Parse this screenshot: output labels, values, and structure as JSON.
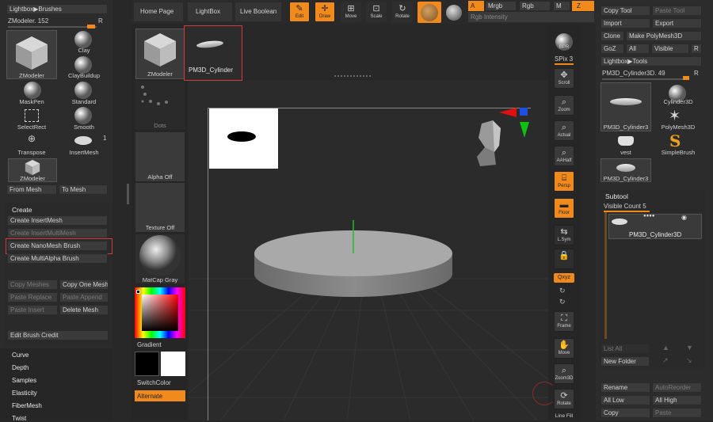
{
  "left": {
    "lightbox_brushes": "Lightbox▶Brushes",
    "zmodeler_value": "ZModeler. 152",
    "r_label": "R",
    "brushes": [
      {
        "name": "ZModeler",
        "icon": "cube-icon"
      },
      {
        "name": "Clay",
        "icon": "sphere-icon"
      },
      {
        "name": "ClayBuildup",
        "icon": "sphere-icon"
      },
      {
        "name": "MaskPen",
        "icon": "sphere-icon"
      },
      {
        "name": "Standard",
        "icon": "sphere-icon"
      },
      {
        "name": "SelectRect",
        "icon": "rect-select-icon"
      },
      {
        "name": "Smooth",
        "icon": "sphere-icon"
      },
      {
        "name": "Transpose",
        "icon": "transpose-icon"
      },
      {
        "name": "InsertMesh",
        "icon": "disc-icon"
      },
      {
        "name": "ZModeler",
        "icon": "cube-icon"
      }
    ],
    "insertmesh_count": "1",
    "from_mesh": "From Mesh",
    "to_mesh": "To Mesh",
    "create_header": "Create",
    "create_insertmesh": "Create InsertMesh",
    "create_insertmultimesh": "Create InsertMultiMesh",
    "create_nanomesh": "Create NanoMesh Brush",
    "create_multialpha": "Create MultiAlpha Brush",
    "copy_meshes": "Copy Meshes",
    "copy_one_mesh": "Copy One Mesh",
    "paste_replace": "Paste Replace",
    "paste_append": "Paste Append",
    "paste_insert": "Paste Insert",
    "delete_mesh": "Delete Mesh",
    "edit_brush_credit": "Edit Brush Credit",
    "menu": [
      "Curve",
      "Depth",
      "Samples",
      "Elasticity",
      "FiberMesh",
      "Twist"
    ]
  },
  "shelf": {
    "zmodeler": "ZModeler",
    "dots": "Dots",
    "alpha_off": "Alpha Off",
    "texture_off": "Texture Off",
    "matcap": "MatCap Gray",
    "gradient": "Gradient",
    "switchcolor": "SwitchColor",
    "alternate": "Alternate"
  },
  "topbar": {
    "tabs": [
      "Home Page",
      "LightBox",
      "Live Boolean"
    ],
    "tools": [
      {
        "label": "Edit",
        "icon": "edit-icon",
        "on": true
      },
      {
        "label": "Draw",
        "icon": "draw-icon",
        "on": true
      },
      {
        "label": "Move",
        "icon": "move-icon",
        "on": false
      },
      {
        "label": "Scale",
        "icon": "scale-icon",
        "on": false
      },
      {
        "label": "Rotate",
        "icon": "rotate-icon",
        "on": false
      }
    ],
    "a_label": "A",
    "mrgb": "Mrgb",
    "rgb": "Rgb",
    "m": "M",
    "z": "Z",
    "rgb_intensity": "Rgb Intensity"
  },
  "popup": {
    "label": "PM3D_Cylinder"
  },
  "righttools": [
    {
      "label": "BPR",
      "icon": "bpr-icon",
      "on": false
    },
    {
      "label": "SPix 3",
      "icon": "",
      "on": false
    },
    {
      "label": "Scroll",
      "icon": "scroll-icon",
      "on": false
    },
    {
      "label": "Zoom",
      "icon": "zoom-icon",
      "on": false
    },
    {
      "label": "Actual",
      "icon": "actual-icon",
      "on": false
    },
    {
      "label": "AAHalf",
      "icon": "aahalf-icon",
      "on": false
    },
    {
      "label": "Persp",
      "icon": "persp-icon",
      "on": true
    },
    {
      "label": "Floor",
      "icon": "floor-icon",
      "on": true
    },
    {
      "label": "L.Sym",
      "icon": "lsym-icon",
      "on": false
    },
    {
      "label": "",
      "icon": "lock-icon",
      "on": false
    },
    {
      "label": "Qxyz",
      "icon": "",
      "on": true
    },
    {
      "label": "Frame",
      "icon": "frame-icon",
      "on": false
    },
    {
      "label": "Move",
      "icon": "move-hand-icon",
      "on": false
    },
    {
      "label": "Zoom3D",
      "icon": "zoom3d-icon",
      "on": false
    },
    {
      "label": "Rotate",
      "icon": "rotate3d-icon",
      "on": false
    },
    {
      "label": "Line Fill",
      "icon": "",
      "on": false
    }
  ],
  "right": {
    "copy_tool": "Copy Tool",
    "paste_tool": "Paste Tool",
    "import": "Import",
    "export": "Export",
    "clone": "Clone",
    "make_polymesh": "Make PolyMesh3D",
    "goz": "GoZ",
    "all": "All",
    "visible": "Visible",
    "r": "R",
    "lightbox_tools": "Lightbox▶Tools",
    "tool_value": "PM3D_Cylinder3D. 49",
    "tools": [
      {
        "name": "PM3D_Cylinder3",
        "icon": "disc-icon"
      },
      {
        "name": "Cylinder3D",
        "icon": "sphere-icon"
      },
      {
        "name": "PolyMesh3D",
        "icon": "star-icon"
      },
      {
        "name": "vest",
        "icon": "vest-icon"
      },
      {
        "name": "SimpleBrush",
        "icon": "s-brush-icon"
      },
      {
        "name": "PM3D_Cylinder3",
        "icon": "disc-icon"
      }
    ],
    "subtool": "Subtool",
    "visible_count": "Visible Count 5",
    "subtool_item": "PM3D_Cylinder3D",
    "list_all": "List All",
    "new_folder": "New Folder",
    "rename": "Rename",
    "autoreorder": "AutoReorder",
    "all_low": "All Low",
    "all_high": "All High",
    "copy": "Copy",
    "paste": "Paste"
  },
  "colors": {
    "accent": "#f08a1c",
    "highlight": "#d43a3a"
  }
}
